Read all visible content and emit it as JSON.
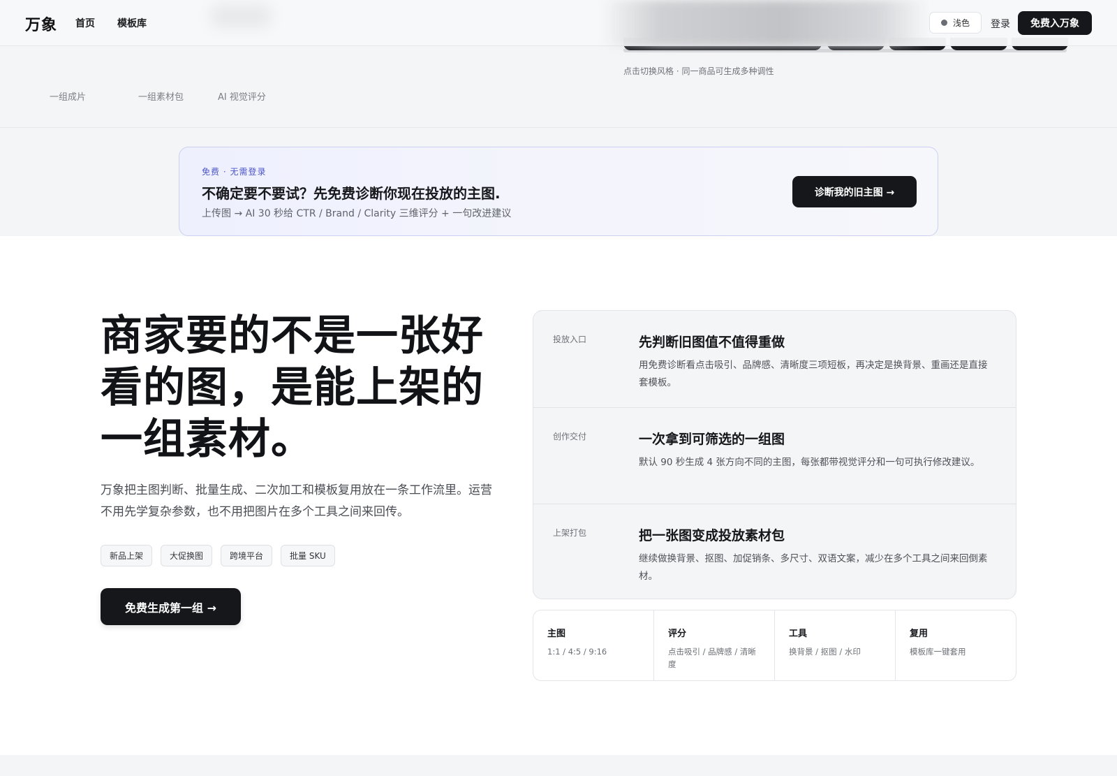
{
  "nav": {
    "logo": "万象",
    "links": [
      "首页",
      "模板库"
    ],
    "theme_label": "浅色",
    "login_label": "登录",
    "cta_label": "免费入万象"
  },
  "top_band": {
    "stat_captions": [
      "一组成片",
      "一组素材包",
      "AI 视觉评分"
    ],
    "style_hint": "点击切换风格 · 同一商品可生成多种调性"
  },
  "banner": {
    "tag": "免费 · 无需登录",
    "title": "不确定要不要试？先免费诊断你现在投放的主图.",
    "subtitle": "上传图 → AI 30 秒给 CTR / Brand / Clarity 三维评分 + 一句改进建议",
    "button_label": "诊断我的旧主图 →"
  },
  "hero": {
    "title": "商家要的不是一张好看的图，是能上架的一组素材。",
    "description": "万象把主图判断、批量生成、二次加工和模板复用放在一条工作流里。运营不用先学复杂参数，也不用把图片在多个工具之间来回传。",
    "tags": [
      "新品上架",
      "大促换图",
      "跨境平台",
      "批量 SKU"
    ],
    "cta_label": "免费生成第一组 →"
  },
  "workflow": [
    {
      "label": "投放入口",
      "title": "先判断旧图值不值得重做",
      "description": "用免费诊断看点击吸引、品牌感、清晰度三项短板，再决定是换背景、重画还是直接套模板。"
    },
    {
      "label": "创作交付",
      "title": "一次拿到可筛选的一组图",
      "description": "默认 90 秒生成 4 张方向不同的主图，每张都带视觉评分和一句可执行修改建议。"
    },
    {
      "label": "上架打包",
      "title": "把一张图变成投放素材包",
      "description": "继续做换背景、抠图、加促销条、多尺寸、双语文案，减少在多个工具之间来回倒素材。"
    }
  ],
  "features": [
    {
      "title": "主图",
      "description": "1:1 / 4:5 / 9:16"
    },
    {
      "title": "评分",
      "description": "点击吸引 / 品牌感 / 清晰度"
    },
    {
      "title": "工具",
      "description": "换背景 / 抠图 / 水印"
    },
    {
      "title": "复用",
      "description": "模板库一键套用"
    }
  ]
}
